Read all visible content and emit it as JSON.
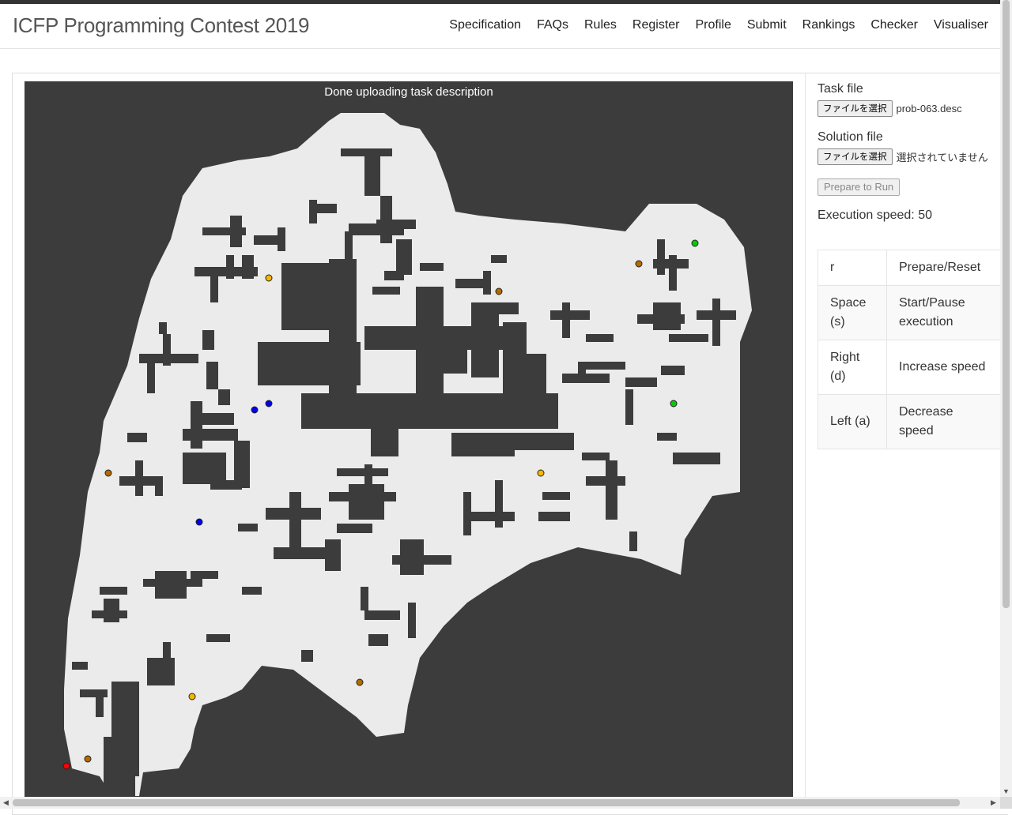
{
  "app": {
    "title": "ICFP Programming Contest 2019"
  },
  "nav": {
    "items": [
      "Specification",
      "FAQs",
      "Rules",
      "Register",
      "Profile",
      "Submit",
      "Rankings",
      "Checker",
      "Visualiser"
    ]
  },
  "canvas": {
    "status": "Done uploading task description",
    "colors": {
      "background": "#3c3c3c",
      "map": "#ebebeb",
      "obstacle": "#3c3c3c",
      "robot": "#ff0000",
      "booster_brown": "#b36b00",
      "booster_yellow": "#f5b800",
      "booster_blue": "#0000ee",
      "booster_green": "#00cc00"
    }
  },
  "sidebar": {
    "task_file_label": "Task file",
    "task_file_button": "ファイルを選択",
    "task_file_name": "prob-063.desc",
    "solution_file_label": "Solution file",
    "solution_file_button": "ファイルを選択",
    "solution_file_name": "選択されていません",
    "prepare_button": "Prepare to Run",
    "speed_label": "Execution speed: 50"
  },
  "shortcuts": [
    {
      "key": "r",
      "action": "Prepare/Reset"
    },
    {
      "key": "Space (s)",
      "action": "Start/Pause execution"
    },
    {
      "key": "Right (d)",
      "action": "Increase speed"
    },
    {
      "key": "Left (a)",
      "action": "Decrease speed"
    }
  ]
}
